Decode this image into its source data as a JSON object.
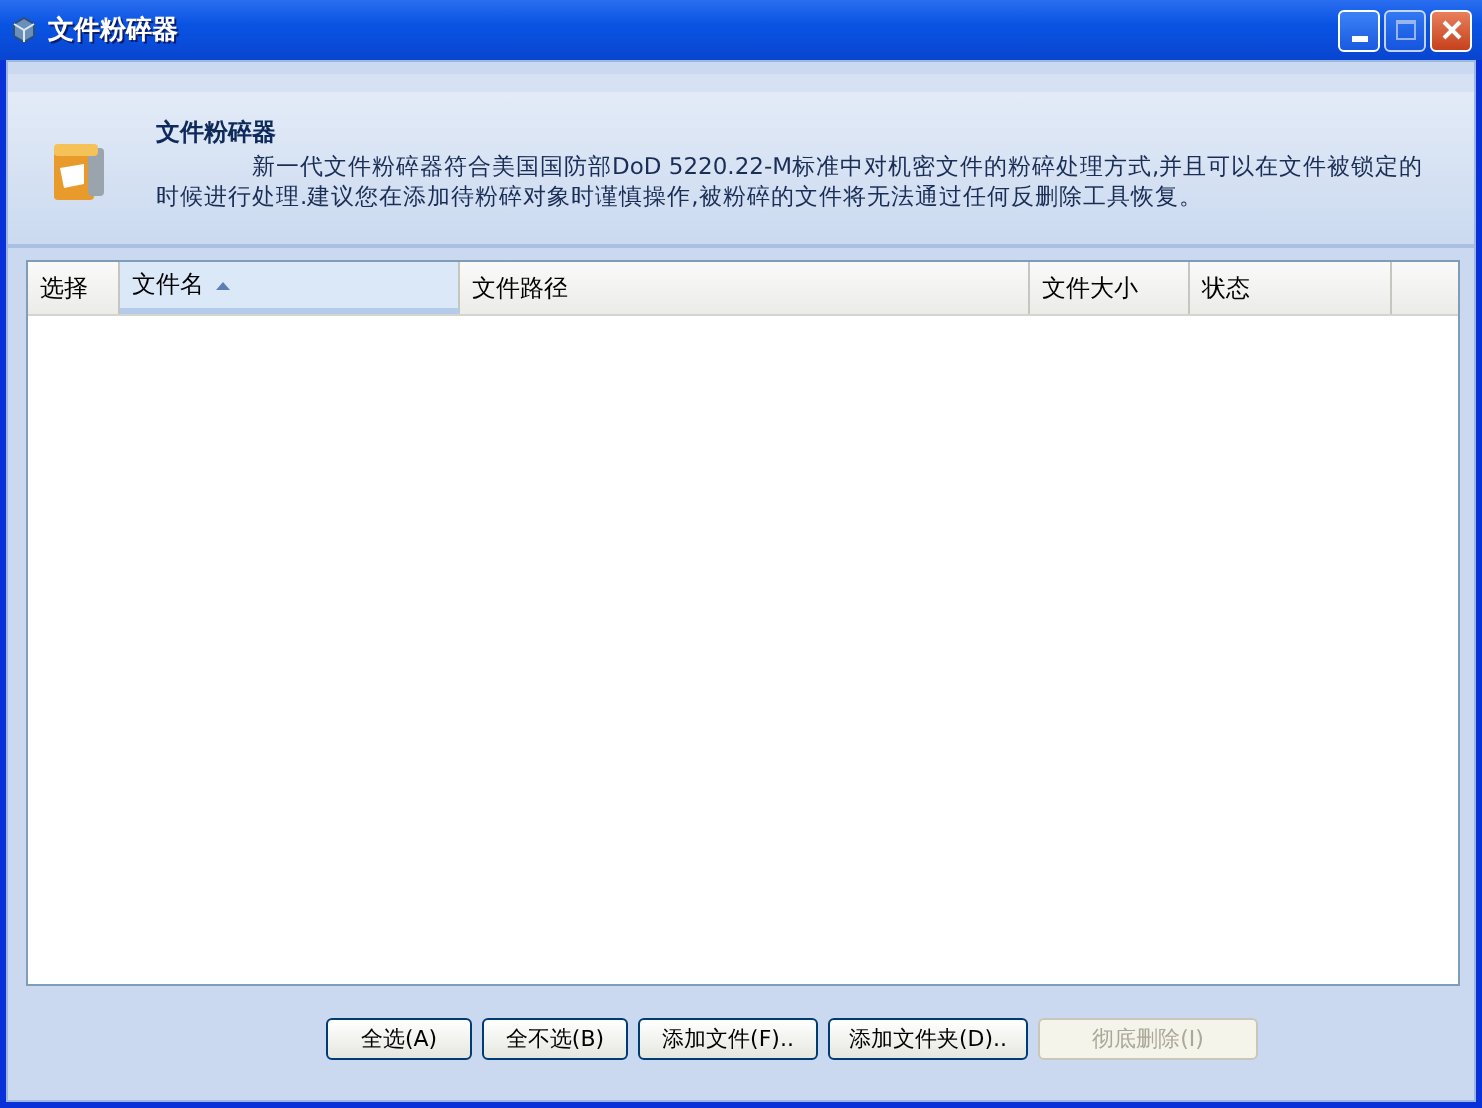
{
  "window": {
    "title": "文件粉碎器"
  },
  "header": {
    "title": "文件粉碎器",
    "description": "新一代文件粉碎器符合美国国防部DoD 5220.22-M标准中对机密文件的粉碎处理方式,并且可以在文件被锁定的时候进行处理.建议您在添加待粉碎对象时谨慎操作,被粉碎的文件将无法通过任何反删除工具恢复。"
  },
  "table": {
    "columns": [
      {
        "label": "选择",
        "sorted": false
      },
      {
        "label": "文件名",
        "sorted": true
      },
      {
        "label": "文件路径",
        "sorted": false
      },
      {
        "label": "文件大小",
        "sorted": false
      },
      {
        "label": "状态",
        "sorted": false
      }
    ]
  },
  "buttons": [
    {
      "label": "全选(A)",
      "disabled": false
    },
    {
      "label": "全不选(B)",
      "disabled": false
    },
    {
      "label": "添加文件(F)..",
      "disabled": false
    },
    {
      "label": "添加文件夹(D)..",
      "disabled": false
    },
    {
      "label": "彻底删除(I)",
      "disabled": true
    }
  ]
}
